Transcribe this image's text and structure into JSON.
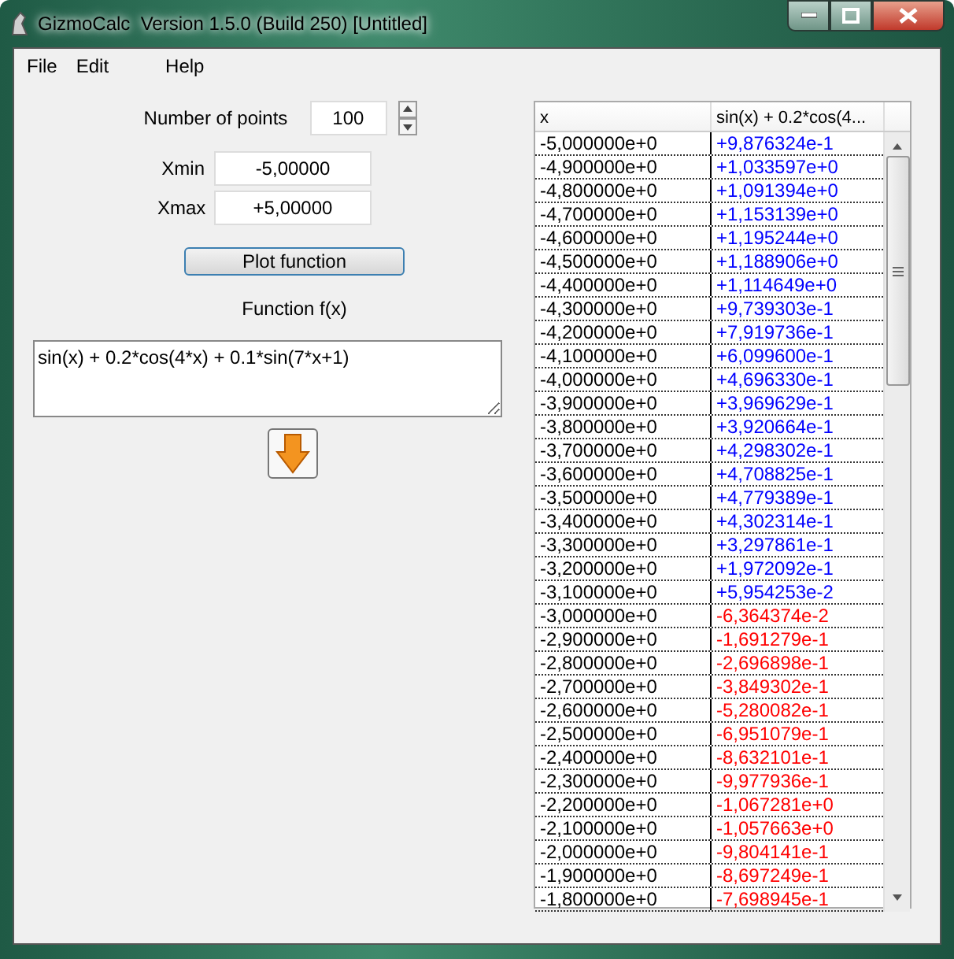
{
  "window": {
    "title": "GizmoCalc  Version 1.5.0 (Build 250) [Untitled]"
  },
  "menu": [
    "File",
    "Edit",
    "Help"
  ],
  "form": {
    "points_label": "Number of points",
    "points": "100",
    "xmin_label": "Xmin",
    "xmin": "-5,00000",
    "xmax_label": "Xmax",
    "xmax": "+5,00000",
    "plot_button": "Plot function",
    "function_label": "Function f(x)",
    "function": "sin(x) + 0.2*cos(4*x) + 0.1*sin(7*x+1)"
  },
  "table": {
    "columns": [
      "x",
      "sin(x) + 0.2*cos(4..."
    ],
    "rows": [
      {
        "x": "-5,000000e+0",
        "value": "+9,876324e-1",
        "color": "#0000ff"
      },
      {
        "x": "-4,900000e+0",
        "value": "+1,033597e+0",
        "color": "#0000ff"
      },
      {
        "x": "-4,800000e+0",
        "value": "+1,091394e+0",
        "color": "#0000ff"
      },
      {
        "x": "-4,700000e+0",
        "value": "+1,153139e+0",
        "color": "#0000ff"
      },
      {
        "x": "-4,600000e+0",
        "value": "+1,195244e+0",
        "color": "#0000ff"
      },
      {
        "x": "-4,500000e+0",
        "value": "+1,188906e+0",
        "color": "#0000ff"
      },
      {
        "x": "-4,400000e+0",
        "value": "+1,114649e+0",
        "color": "#0000ff"
      },
      {
        "x": "-4,300000e+0",
        "value": "+9,739303e-1",
        "color": "#0000ff"
      },
      {
        "x": "-4,200000e+0",
        "value": "+7,919736e-1",
        "color": "#0000ff"
      },
      {
        "x": "-4,100000e+0",
        "value": "+6,099600e-1",
        "color": "#0000ff"
      },
      {
        "x": "-4,000000e+0",
        "value": "+4,696330e-1",
        "color": "#0000ff"
      },
      {
        "x": "-3,900000e+0",
        "value": "+3,969629e-1",
        "color": "#0000ff"
      },
      {
        "x": "-3,800000e+0",
        "value": "+3,920664e-1",
        "color": "#0000ff"
      },
      {
        "x": "-3,700000e+0",
        "value": "+4,298302e-1",
        "color": "#0000ff"
      },
      {
        "x": "-3,600000e+0",
        "value": "+4,708825e-1",
        "color": "#0000ff"
      },
      {
        "x": "-3,500000e+0",
        "value": "+4,779389e-1",
        "color": "#0000ff"
      },
      {
        "x": "-3,400000e+0",
        "value": "+4,302314e-1",
        "color": "#0000ff"
      },
      {
        "x": "-3,300000e+0",
        "value": "+3,297861e-1",
        "color": "#0000ff"
      },
      {
        "x": "-3,200000e+0",
        "value": "+1,972092e-1",
        "color": "#0000ff"
      },
      {
        "x": "-3,100000e+0",
        "value": "+5,954253e-2",
        "color": "#0000ff"
      },
      {
        "x": "-3,000000e+0",
        "value": "-6,364374e-2",
        "color": "#ff0000"
      },
      {
        "x": "-2,900000e+0",
        "value": "-1,691279e-1",
        "color": "#ff0000"
      },
      {
        "x": "-2,800000e+0",
        "value": "-2,696898e-1",
        "color": "#ff0000"
      },
      {
        "x": "-2,700000e+0",
        "value": "-3,849302e-1",
        "color": "#ff0000"
      },
      {
        "x": "-2,600000e+0",
        "value": "-5,280082e-1",
        "color": "#ff0000"
      },
      {
        "x": "-2,500000e+0",
        "value": "-6,951079e-1",
        "color": "#ff0000"
      },
      {
        "x": "-2,400000e+0",
        "value": "-8,632101e-1",
        "color": "#ff0000"
      },
      {
        "x": "-2,300000e+0",
        "value": "-9,977936e-1",
        "color": "#ff0000"
      },
      {
        "x": "-2,200000e+0",
        "value": "-1,067281e+0",
        "color": "#ff0000"
      },
      {
        "x": "-2,100000e+0",
        "value": "-1,057663e+0",
        "color": "#ff0000"
      },
      {
        "x": "-2,000000e+0",
        "value": "-9,804141e-1",
        "color": "#ff0000"
      },
      {
        "x": "-1,900000e+0",
        "value": "-8,697249e-1",
        "color": "#ff0000"
      },
      {
        "x": "-1,800000e+0",
        "value": "-7,698945e-1",
        "color": "#ff0000"
      }
    ]
  }
}
